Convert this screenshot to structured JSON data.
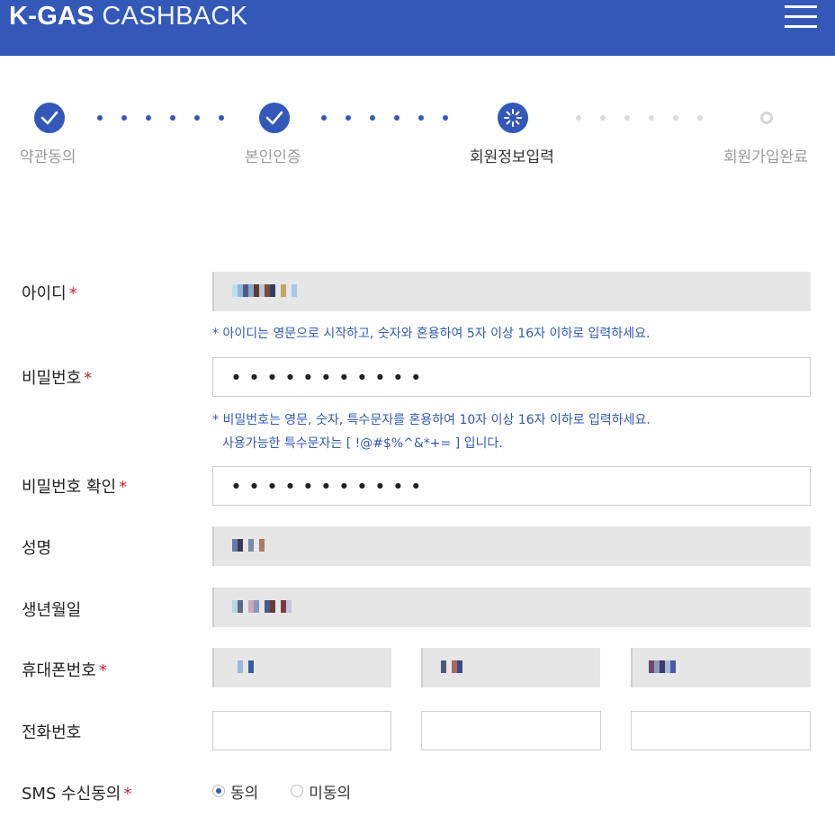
{
  "header": {
    "logo_bold": "K-GAS",
    "logo_light": "CASHBACK",
    "brand_color": "#3358b8",
    "menu_icon": "hamburger-menu-icon"
  },
  "steps": [
    {
      "label": "약관동의",
      "status": "done",
      "icon": "check-icon"
    },
    {
      "label": "본인인증",
      "status": "done",
      "icon": "check-icon"
    },
    {
      "label": "회원정보입력",
      "status": "current",
      "icon": "loading-spinner-icon"
    },
    {
      "label": "회원가입완료",
      "status": "pending",
      "icon": "empty-circle-icon"
    }
  ],
  "form": {
    "id": {
      "label": "아이디",
      "required_mark": "*",
      "hint": "* 아이디는 영문으로 시작하고, 숫자와 혼용하여 5자 이상 16자 이하로 입력하세요."
    },
    "password": {
      "label": "비밀번호",
      "required_mark": "*",
      "masked_value": "●●●●●●●●●●●",
      "hint_line1": "* 비밀번호는 영문, 숫자, 특수문자를 혼용하여 10자 이상 16자 이하로 입력하세요.",
      "hint_line2": "사용가능한 특수문자는 [ !@#$%^&*+= ] 입니다."
    },
    "password_confirm": {
      "label": "비밀번호 확인",
      "required_mark": "*",
      "masked_value": "●●●●●●●●●●●"
    },
    "name": {
      "label": "성명"
    },
    "birth": {
      "label": "생년월일"
    },
    "mobile": {
      "label": "휴대폰번호",
      "required_mark": "*"
    },
    "phone": {
      "label": "전화번호"
    },
    "sms": {
      "label": "SMS 수신동의",
      "required_mark": "*",
      "options": [
        "동의",
        "미동의"
      ],
      "selected": "동의"
    }
  }
}
